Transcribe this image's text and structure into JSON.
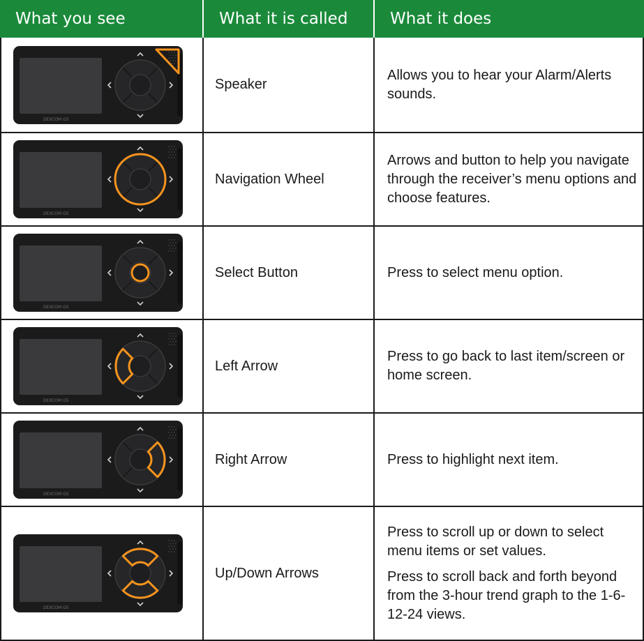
{
  "header": {
    "col1": "What you see",
    "col2": "What it is called",
    "col3": "What it does"
  },
  "device": {
    "brand_text": "DEXCOM G5",
    "highlight_color": "#f7941d",
    "header_color": "#1a8a3a"
  },
  "rows": [
    {
      "name": "Speaker",
      "highlight": "speaker",
      "desc": [
        "Allows you to hear your Alarm/Alerts sounds."
      ]
    },
    {
      "name": "Navigation Wheel",
      "highlight": "wheel",
      "desc": [
        "Arrows and button to help you navigate through the receiver’s menu options and choose features."
      ]
    },
    {
      "name": "Select Button",
      "highlight": "select",
      "desc": [
        "Press to select menu option."
      ]
    },
    {
      "name": "Left Arrow",
      "highlight": "left",
      "desc": [
        "Press to go back to last item/screen or home screen."
      ]
    },
    {
      "name": "Right Arrow",
      "highlight": "right",
      "desc": [
        "Press to highlight next item."
      ]
    },
    {
      "name": "Up/Down Arrows",
      "highlight": "updown",
      "desc": [
        "Press to scroll up or down to select menu items or set values.",
        "Press to scroll back and forth beyond from the 3-hour trend graph to the 1-6-12-24 views."
      ]
    }
  ]
}
